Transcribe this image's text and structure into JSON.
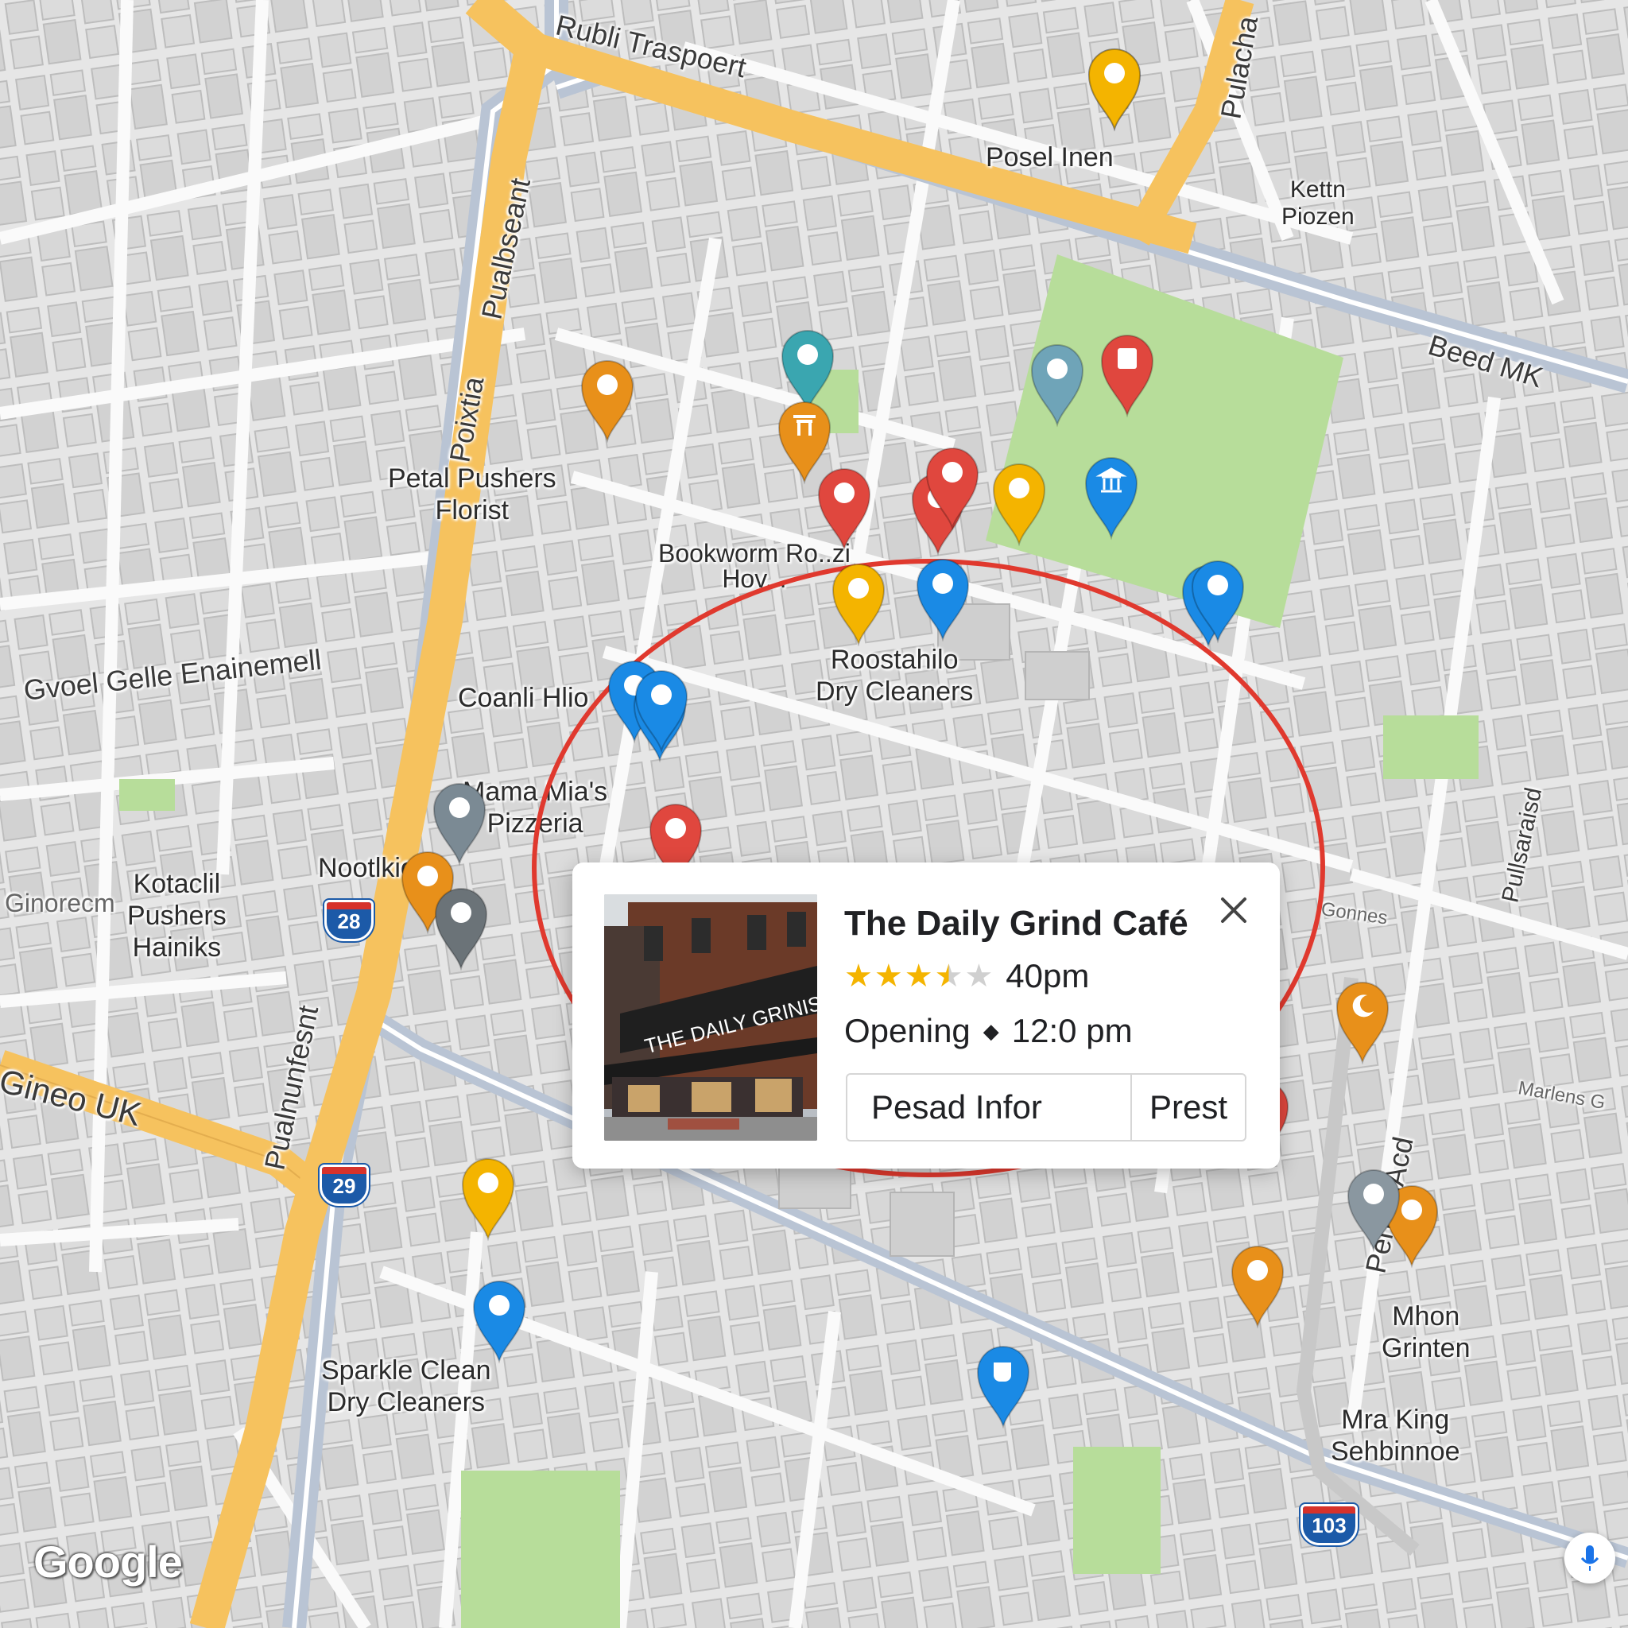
{
  "map": {
    "brand": "Google",
    "places": [
      {
        "id": "posel",
        "text": [
          "Posel Inen"
        ]
      },
      {
        "id": "kettn",
        "text": [
          "Kettn",
          "Piozen"
        ]
      },
      {
        "id": "petal",
        "text": [
          "Petal Pushers",
          "Florist"
        ]
      },
      {
        "id": "bookworm",
        "text": [
          "Bookworm Ro..zi",
          "Hov..."
        ]
      },
      {
        "id": "roostahilo",
        "text": [
          "Roostahilo",
          "Dry Cleaners"
        ]
      },
      {
        "id": "coanli",
        "text": [
          "Coanli Hlio"
        ]
      },
      {
        "id": "mamamia",
        "text": [
          "Mama Mia's",
          "Pizzeria"
        ]
      },
      {
        "id": "nootlkion",
        "text": [
          "Nootlkion"
        ]
      },
      {
        "id": "kotaclil",
        "text": [
          "Kotaclil",
          "Pushers",
          "Hainiks"
        ]
      },
      {
        "id": "sparkle",
        "text": [
          "Sparkle Clean",
          "Dry Cleaners"
        ]
      },
      {
        "id": "mhon",
        "text": [
          "Mhon",
          "Grinten"
        ]
      },
      {
        "id": "mraking",
        "text": [
          "Mra King",
          "Sehbinnoe"
        ]
      }
    ],
    "roads": [
      {
        "id": "rubli",
        "text": "Rubli Traspoert"
      },
      {
        "id": "pulacha",
        "text": "Pulacha"
      },
      {
        "id": "beed",
        "text": "Beed MK"
      },
      {
        "id": "pualbseant",
        "text": "Pualbseant"
      },
      {
        "id": "poixtia",
        "text": "Poixtia"
      },
      {
        "id": "gvoel",
        "text": "Gvoel Gelle Enainemell"
      },
      {
        "id": "gineo",
        "text": "Gineo UK"
      },
      {
        "id": "pualnunfesnt",
        "text": "Pualnunfesnt"
      },
      {
        "id": "pengeiacd",
        "text": "PengeiAcd"
      },
      {
        "id": "pullsaraisd",
        "text": "Pullsaraisd"
      },
      {
        "id": "ginorecm",
        "text": "Ginorecm"
      },
      {
        "id": "marlens",
        "text": "Marlens G"
      },
      {
        "id": "gonnes",
        "text": "Gonnes"
      }
    ],
    "shields": [
      "28",
      "29",
      "103"
    ],
    "pins": [
      {
        "color": "#f4b400",
        "glyph": "dot"
      },
      {
        "color": "#f4b400",
        "glyph": "dot"
      },
      {
        "color": "#e8901a",
        "glyph": "dot"
      },
      {
        "color": "#f4b400",
        "glyph": "dot"
      },
      {
        "color": "#1a8ae5",
        "glyph": "dot"
      },
      {
        "color": "#1a8ae5",
        "glyph": "dot"
      },
      {
        "color": "#1a8ae5",
        "glyph": "dot"
      },
      {
        "color": "#7b8a94",
        "glyph": "dot"
      },
      {
        "color": "#e0473e",
        "glyph": "dot"
      },
      {
        "color": "#e8901a",
        "glyph": "dot"
      },
      {
        "color": "#6b7378",
        "glyph": "dot"
      },
      {
        "color": "#f4b400",
        "glyph": "dot"
      },
      {
        "color": "#1a8ae5",
        "glyph": "dot"
      },
      {
        "color": "#3aa6b0",
        "glyph": "dot"
      },
      {
        "color": "#e8901a",
        "glyph": "shrine"
      },
      {
        "color": "#e0473e",
        "glyph": "dot"
      },
      {
        "color": "#e0473e",
        "glyph": "dot"
      },
      {
        "color": "#e0473e",
        "glyph": "dot"
      },
      {
        "color": "#f4b400",
        "glyph": "dot"
      },
      {
        "color": "#1a8ae5",
        "glyph": "dot"
      },
      {
        "color": "#1a8ae5",
        "glyph": "bank"
      },
      {
        "color": "#6fa4b8",
        "glyph": "dot"
      },
      {
        "color": "#e0473e",
        "glyph": "square"
      },
      {
        "color": "#1a8ae5",
        "glyph": "dot"
      },
      {
        "color": "#1a8ae5",
        "glyph": "dot"
      },
      {
        "color": "#e8901a",
        "glyph": "moon"
      },
      {
        "color": "#e0473e",
        "glyph": "dot"
      },
      {
        "color": "#e8901a",
        "glyph": "dot"
      },
      {
        "color": "#e8901a",
        "glyph": "dot"
      },
      {
        "color": "#8a97a0",
        "glyph": "dot"
      },
      {
        "color": "#1a8ae5",
        "glyph": "cup"
      },
      {
        "color": "#e0473e",
        "glyph": "dot"
      }
    ]
  },
  "card": {
    "title": "The Daily Grind Café",
    "stars": 3.5,
    "rating_text": "40pm",
    "status": "Opening",
    "hours": "12:0 pm",
    "button_info": "Pesad Infor",
    "button_prest": "Prest",
    "photo_sign": "THE DAILY GRINIS",
    "close_icon": "close-icon"
  },
  "colors": {
    "highway": "#f6c25e",
    "arterial": "#b9c4d4",
    "park": "#b7dd9a",
    "circle": "#e0392e"
  }
}
